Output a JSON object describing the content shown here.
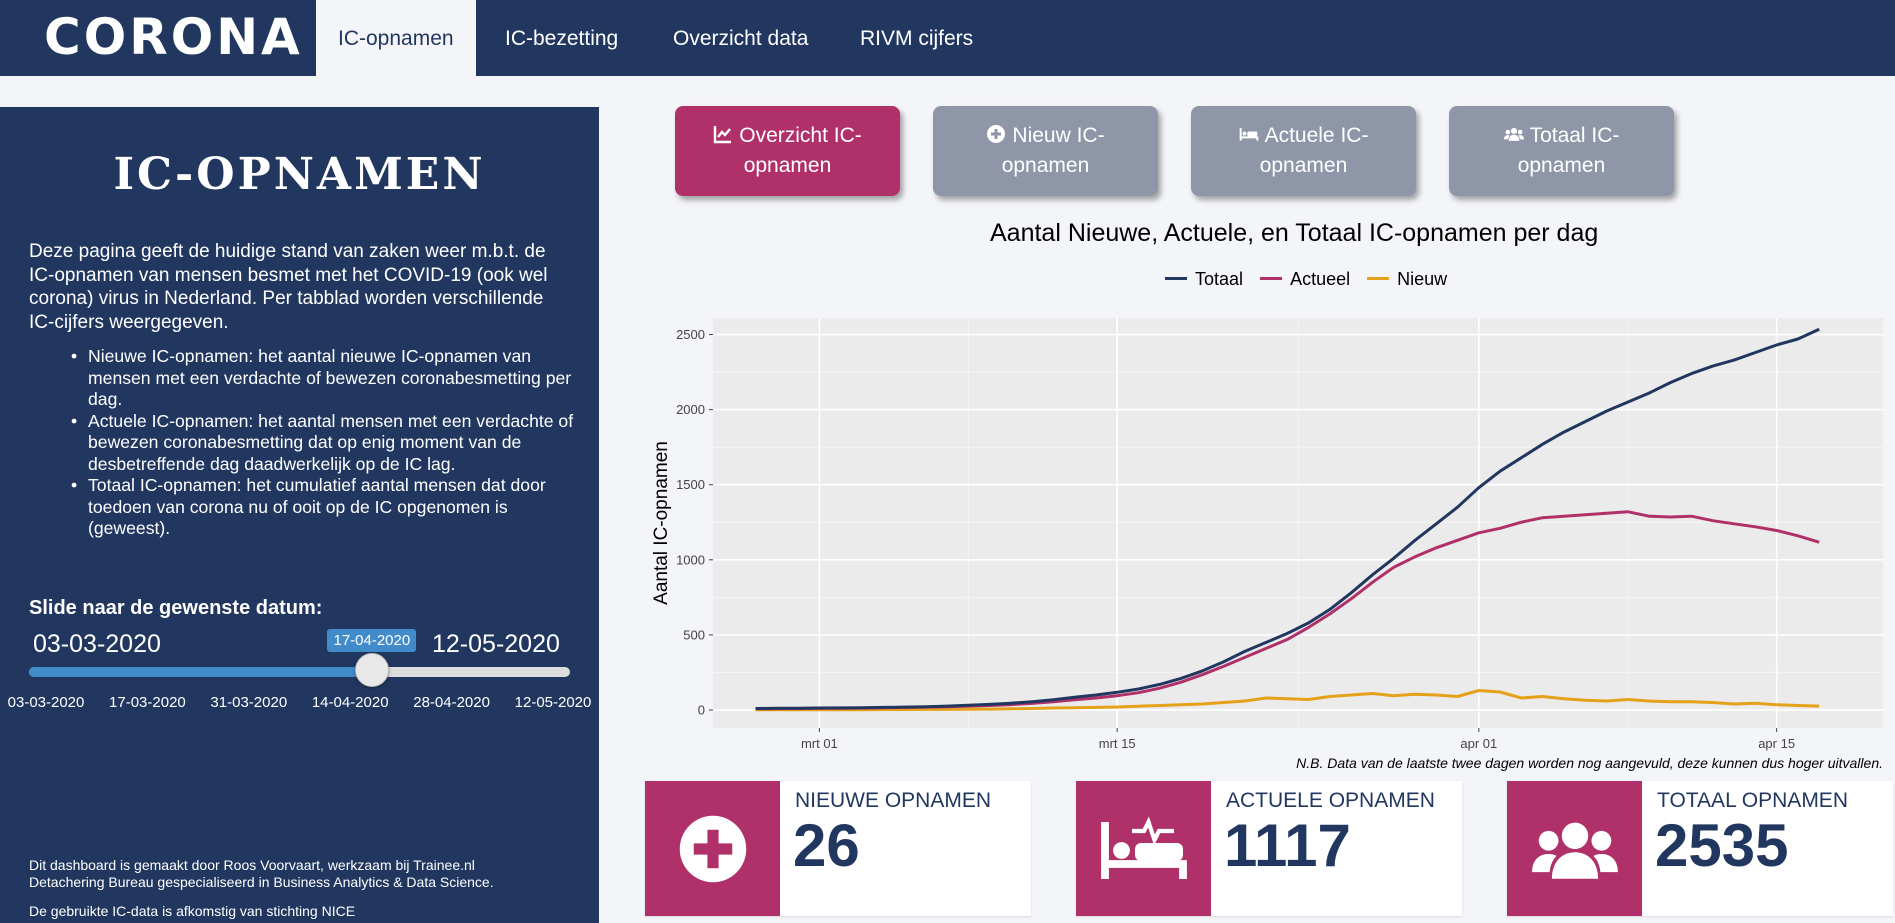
{
  "app": {
    "logo": "CORONA"
  },
  "nav": {
    "tabs": [
      {
        "label": "IC-opnamen",
        "active": true
      },
      {
        "label": "IC-bezetting",
        "active": false
      },
      {
        "label": "Overzicht data",
        "active": false
      },
      {
        "label": "RIVM cijfers",
        "active": false
      }
    ]
  },
  "sidebar": {
    "title": "IC-OPNAMEN",
    "intro": "Deze pagina geeft de huidige stand van zaken weer m.b.t. de IC-opnamen van mensen besmet met het COVID-19 (ook wel corona) virus in Nederland. Per tabblad worden verschillende IC-cijfers weergegeven.",
    "bullets": [
      "Nieuwe IC-opnamen: het aantal nieuwe IC-opnamen van mensen met een verdachte of bewezen coronabesmetting per dag.",
      "Actuele IC-opnamen: het aantal mensen met een verdachte of bewezen coronabesmetting dat op enig moment van de desbetreffende dag daadwerkelijk op de IC lag.",
      "Totaal IC-opnamen: het cumulatief aantal mensen dat door toedoen van corona nu of ooit op de IC opgenomen is (geweest)."
    ],
    "slider": {
      "label": "Slide naar de gewenste datum:",
      "min": "03-03-2020",
      "max": "12-05-2020",
      "value": "17-04-2020",
      "value_fraction": 0.634,
      "ticks": [
        "03-03-2020",
        "17-03-2020",
        "31-03-2020",
        "14-04-2020",
        "28-04-2020",
        "12-05-2020"
      ]
    },
    "footer": {
      "author_line1": "Dit dashboard is gemaakt door Roos Voorvaart, werkzaam bij Trainee.nl",
      "author_line2": "Detachering Bureau gespecialiseerd in Business Analytics & Data Science.",
      "source": "De gebruikte IC-data is afkomstig van stichting NICE"
    }
  },
  "buttons": [
    {
      "label": "Overzicht IC-opnamen",
      "icon": "chart-line-icon",
      "active": true
    },
    {
      "label": "Nieuw IC-opnamen",
      "icon": "plus-circle-icon",
      "active": false
    },
    {
      "label": "Actuele IC-opnamen",
      "icon": "hospital-bed-icon",
      "active": false
    },
    {
      "label": "Totaal IC-opnamen",
      "icon": "users-icon",
      "active": false
    }
  ],
  "colors": {
    "navy": "#213760",
    "magenta": "#b0306a",
    "orange": "#e5a11a",
    "inactive_button": "#8e96a8"
  },
  "chart_data": {
    "type": "line",
    "title": "Aantal Nieuwe, Actuele, en Totaal IC-opnamen per dag",
    "ylabel": "Aantal IC-opnamen",
    "xlabel": "",
    "xlim": [
      "2020-02-25",
      "2020-04-20"
    ],
    "ylim": [
      -120,
      2610
    ],
    "yticks": [
      0,
      500,
      1000,
      1500,
      2000,
      2500
    ],
    "xticks": [
      {
        "date": "2020-03-01",
        "label": "mrt 01"
      },
      {
        "date": "2020-03-15",
        "label": "mrt 15"
      },
      {
        "date": "2020-04-01",
        "label": "apr 01"
      },
      {
        "date": "2020-04-15",
        "label": "apr 15"
      }
    ],
    "legend_position": "top",
    "grid": true,
    "x": [
      "2020-02-27",
      "2020-02-28",
      "2020-02-29",
      "2020-03-01",
      "2020-03-02",
      "2020-03-03",
      "2020-03-04",
      "2020-03-05",
      "2020-03-06",
      "2020-03-07",
      "2020-03-08",
      "2020-03-09",
      "2020-03-10",
      "2020-03-11",
      "2020-03-12",
      "2020-03-13",
      "2020-03-14",
      "2020-03-15",
      "2020-03-16",
      "2020-03-17",
      "2020-03-18",
      "2020-03-19",
      "2020-03-20",
      "2020-03-21",
      "2020-03-22",
      "2020-03-23",
      "2020-03-24",
      "2020-03-25",
      "2020-03-26",
      "2020-03-27",
      "2020-03-28",
      "2020-03-29",
      "2020-03-30",
      "2020-03-31",
      "2020-04-01",
      "2020-04-02",
      "2020-04-03",
      "2020-04-04",
      "2020-04-05",
      "2020-04-06",
      "2020-04-07",
      "2020-04-08",
      "2020-04-09",
      "2020-04-10",
      "2020-04-11",
      "2020-04-12",
      "2020-04-13",
      "2020-04-14",
      "2020-04-15",
      "2020-04-16",
      "2020-04-17"
    ],
    "series": [
      {
        "name": "Totaal",
        "color": "#213760",
        "values": [
          10,
          11,
          12,
          13,
          14,
          15,
          17,
          19,
          22,
          26,
          31,
          37,
          45,
          55,
          68,
          85,
          100,
          118,
          140,
          170,
          210,
          260,
          320,
          390,
          450,
          510,
          580,
          670,
          780,
          900,
          1010,
          1130,
          1240,
          1350,
          1480,
          1590,
          1680,
          1770,
          1850,
          1920,
          1990,
          2050,
          2110,
          2180,
          2240,
          2290,
          2330,
          2380,
          2430,
          2470,
          2535
        ]
      },
      {
        "name": "Actueel",
        "color": "#b0306a",
        "values": [
          8,
          9,
          10,
          11,
          12,
          13,
          15,
          17,
          19,
          22,
          26,
          30,
          36,
          44,
          55,
          68,
          80,
          95,
          115,
          145,
          185,
          235,
          290,
          350,
          410,
          470,
          550,
          640,
          740,
          850,
          950,
          1020,
          1080,
          1130,
          1180,
          1210,
          1250,
          1280,
          1290,
          1300,
          1310,
          1320,
          1290,
          1285,
          1290,
          1260,
          1240,
          1220,
          1195,
          1160,
          1117
        ]
      },
      {
        "name": "Nieuw",
        "color": "#e5a11a",
        "values": [
          2,
          1,
          1,
          1,
          2,
          2,
          3,
          3,
          4,
          4,
          5,
          6,
          8,
          10,
          13,
          15,
          17,
          20,
          25,
          30,
          35,
          40,
          50,
          60,
          80,
          75,
          70,
          90,
          100,
          110,
          95,
          105,
          100,
          90,
          130,
          120,
          80,
          90,
          75,
          65,
          60,
          70,
          60,
          55,
          55,
          50,
          40,
          45,
          35,
          30,
          26
        ]
      }
    ]
  },
  "value_boxes": [
    {
      "label": "NIEUWE OPNAMEN",
      "value": "26",
      "icon": "plus-circle-icon"
    },
    {
      "label": "ACTUELE OPNAMEN",
      "value": "1117",
      "icon": "hospital-bed-icon"
    },
    {
      "label": "TOTAAL OPNAMEN",
      "value": "2535",
      "icon": "users-icon"
    }
  ],
  "chart_footnote": "N.B. Data van de laatste twee dagen worden nog aangevuld, deze kunnen dus hoger uitvallen."
}
